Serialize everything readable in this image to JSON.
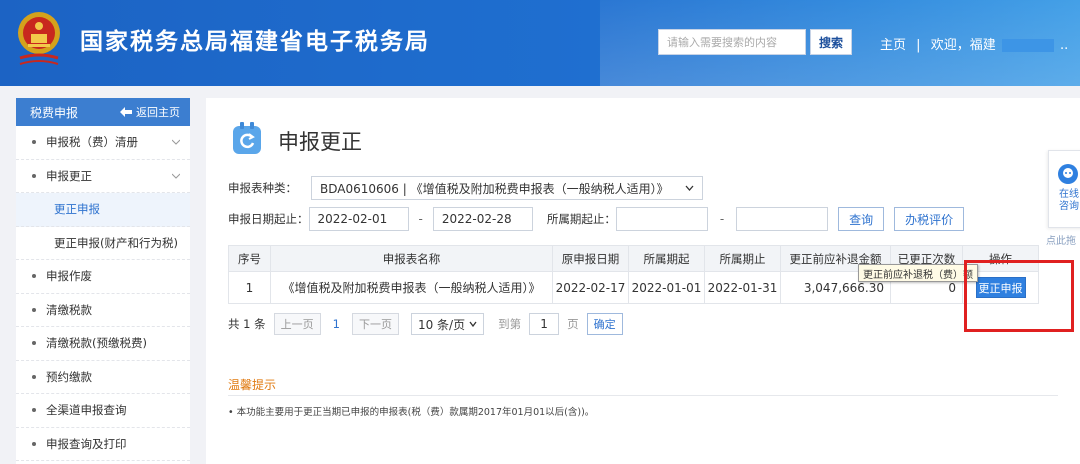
{
  "header": {
    "site_title": "国家税务总局福建省电子税务局",
    "search_placeholder": "请输入需要搜索的内容",
    "search_button": "搜索",
    "nav_home": "主页",
    "nav_welcome": "欢迎，福建",
    "nav_welcome_tail": "..",
    "nav_exit": "退出"
  },
  "sidebar": {
    "title": "税费申报",
    "back": "返回主页",
    "items": [
      {
        "label": "申报税（费）清册"
      },
      {
        "label": "申报更正"
      },
      {
        "label": "更正申报"
      },
      {
        "label": "更正申报(财产和行为税)"
      },
      {
        "label": "申报作废"
      },
      {
        "label": "清缴税款"
      },
      {
        "label": "清缴税款(预缴税费)"
      },
      {
        "label": "预约缴款"
      },
      {
        "label": "全渠道申报查询"
      },
      {
        "label": "申报查询及打印"
      }
    ]
  },
  "main": {
    "title": "申报更正",
    "form": {
      "type_label": "申报表种类：",
      "type_value": "BDA0610606 | 《增值税及附加税费申报表（一般纳税人适用）》",
      "date_label": "申报日期起止：",
      "date_start": "2022-02-01",
      "date_end": "2022-02-28",
      "period_label": "所属期起止：",
      "period_start": "",
      "period_end": "",
      "dash": "-",
      "query_button": "查询",
      "rate_button": "办税评价"
    },
    "table": {
      "headers": [
        "序号",
        "申报表名称",
        "原申报日期",
        "所属期起",
        "所属期止",
        "更正前应补退金额",
        "已更正次数",
        "操作"
      ],
      "rows": [
        {
          "no": "1",
          "name": "《增值税及附加税费申报表（一般纳税人适用）》",
          "orig_date": "2022-02-17",
          "period_start": "2022-01-01",
          "period_end": "2022-01-31",
          "amount": "3,047,666.30",
          "times": "0",
          "action": "更正申报"
        }
      ]
    },
    "tooltip": "更正前应补退税（费）额",
    "pager": {
      "total": "共 1 条",
      "prev": "上一页",
      "current": "1",
      "next": "下一页",
      "page_size": "10 条/页",
      "goto_label": "到第",
      "goto_value": "1",
      "page_unit": "页",
      "confirm": "确定"
    },
    "tips": {
      "title": "温馨提示",
      "text": "• 本功能主要用于更正当期已申报的申报表(税（费）款属期2017年01月01以后(含))。"
    }
  },
  "float_widget": {
    "label": "在线咨询",
    "drag_hint": "点此拖"
  },
  "colors": {
    "header_blue": "#1f6fd0",
    "accent": "#2f80e0",
    "highlight_red": "#e02020",
    "tips_orange": "#e07a10"
  }
}
